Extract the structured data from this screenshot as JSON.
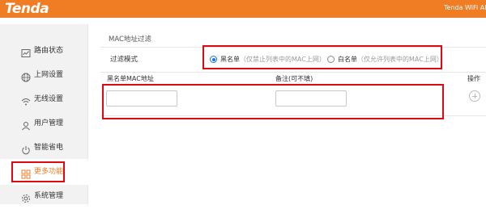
{
  "header": {
    "logo": "Tenda",
    "product": "Tenda WiFi AP"
  },
  "sidebar": {
    "items": [
      {
        "label": "路由状态",
        "icon": "chart-icon"
      },
      {
        "label": "上网设置",
        "icon": "globe-icon"
      },
      {
        "label": "无线设置",
        "icon": "wifi-icon"
      },
      {
        "label": "用户管理",
        "icon": "user-icon"
      },
      {
        "label": "智能省电",
        "icon": "power-icon"
      },
      {
        "label": "更多功能",
        "icon": "grid-icon",
        "active": true
      },
      {
        "label": "系统管理",
        "icon": "gear-icon"
      }
    ]
  },
  "main": {
    "section_title": "MAC地址过滤",
    "filter_mode": {
      "label": "过滤模式",
      "options": [
        {
          "label": "黑名单",
          "hint": "（仅禁止列表中的MAC上网）",
          "selected": true
        },
        {
          "label": "白名单",
          "hint": "（仅允许列表中的MAC上网）",
          "selected": false
        }
      ]
    },
    "table": {
      "columns": [
        "黑名单MAC地址",
        "备注(可不填)",
        "操作"
      ],
      "row": {
        "mac_value": "",
        "note_value": ""
      }
    }
  },
  "colors": {
    "brand": "#f07c24",
    "highlight": "#e30613",
    "radio_selected": "#1a73e8"
  }
}
